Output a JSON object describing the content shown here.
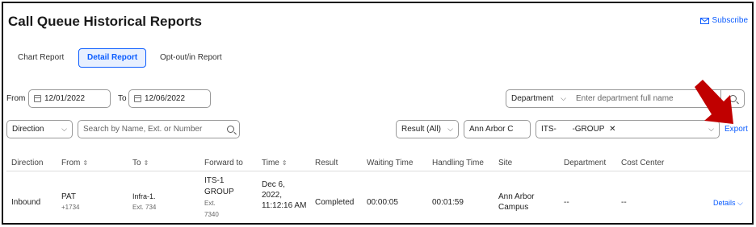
{
  "page": {
    "title": "Call Queue Historical Reports",
    "subscribe_label": "Subscribe",
    "accent": "#0b5cff"
  },
  "tabs": [
    {
      "label": "Chart Report"
    },
    {
      "label": "Detail Report"
    },
    {
      "label": "Opt-out/in Report"
    }
  ],
  "filters": {
    "from_label": "From",
    "from_value": "12/01/2022",
    "to_label": "To",
    "to_value": "12/06/2022",
    "department_select": "Department",
    "department_placeholder": "Enter department full name",
    "direction_select": "Direction",
    "search_placeholder": "Search by Name, Ext. or Number",
    "result_select": "Result (All)",
    "site_value": "Ann Arbor C",
    "queue_tag_a": "ITS-",
    "queue_tag_b": "-GROUP",
    "export_label": "Export"
  },
  "table": {
    "headers": [
      "Direction",
      "From",
      "To",
      "Forward to",
      "Time",
      "Result",
      "Waiting Time",
      "Handling Time",
      "Site",
      "Department",
      "Cost Center"
    ],
    "row": {
      "direction": "Inbound",
      "from_name": "PAT",
      "from_number": "+1734",
      "to_name": "Infra-1.",
      "to_ext": "Ext. 734",
      "forward_line1": "ITS-1",
      "forward_line2": "GROUP",
      "forward_line3": "Ext.",
      "forward_line4": "7340",
      "time_line1": "Dec 6,",
      "time_line2": "2022,",
      "time_line3": "11:12:16 AM",
      "result": "Completed",
      "waiting_time": "00:00:05",
      "handling_time": "00:01:59",
      "site_line1": "Ann Arbor",
      "site_line2": "Campus",
      "department": "--",
      "cost_center": "--",
      "details_label": "Details"
    }
  }
}
